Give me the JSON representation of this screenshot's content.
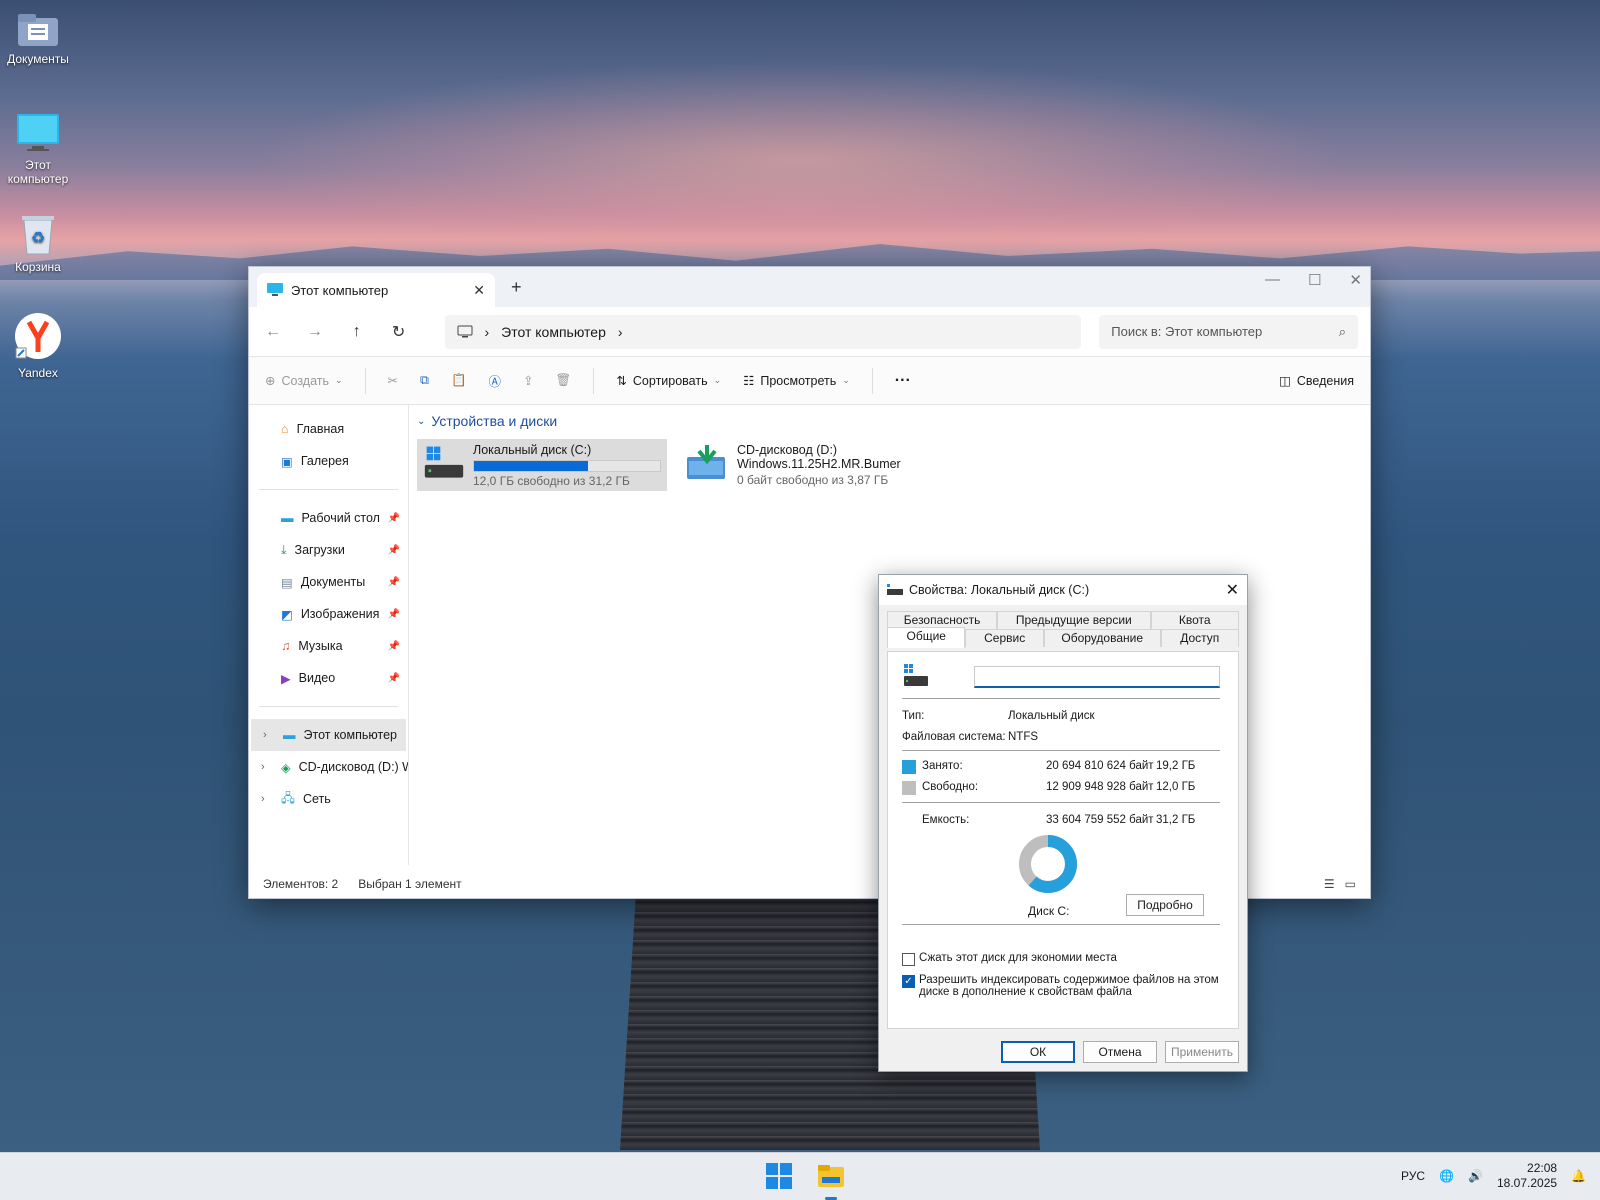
{
  "desktop": {
    "icons": [
      {
        "label": "Документы"
      },
      {
        "label": "Этот компьютер"
      },
      {
        "label": "Корзина"
      },
      {
        "label": "Yandex"
      }
    ]
  },
  "explorer": {
    "tab_title": "Этот компьютер",
    "address_path": "Этот компьютер",
    "search_placeholder": "Поиск в: Этот компьютер",
    "toolbar": {
      "create": "Создать",
      "sort": "Сортировать",
      "view": "Просмотреть",
      "details": "Сведения"
    },
    "nav": {
      "home": "Главная",
      "gallery": "Галерея",
      "desktop": "Рабочий стол",
      "downloads": "Загрузки",
      "documents": "Документы",
      "images": "Изображения",
      "music": "Музыка",
      "video": "Видео",
      "this_pc": "Этот компьютер",
      "cd_drive": "CD-дисковод (D:) W",
      "network": "Сеть"
    },
    "section_title": "Устройства и диски",
    "drives": [
      {
        "name": "Локальный диск (C:)",
        "sub": "12,0 ГБ свободно из 31,2 ГБ",
        "used_fraction": 0.615
      },
      {
        "name": "CD-дисковод (D:)",
        "label": "Windows.11.25H2.MR.Bumer",
        "sub": "0 байт свободно из 3,87 ГБ"
      }
    ],
    "status": {
      "items": "Элементов: 2",
      "selected": "Выбран 1 элемент"
    }
  },
  "properties": {
    "title": "Свойства: Локальный диск (C:)",
    "tabs_row1": [
      "Безопасность",
      "Предыдущие версии",
      "Квота"
    ],
    "tabs_row2": [
      "Общие",
      "Сервис",
      "Оборудование",
      "Доступ"
    ],
    "name_value": "",
    "type_label": "Тип:",
    "type_value": "Локальный диск",
    "fs_label": "Файловая система:",
    "fs_value": "NTFS",
    "used_label": "Занято:",
    "used_bytes": "20 694 810 624 байт",
    "used_gb": "19,2 ГБ",
    "free_label": "Свободно:",
    "free_bytes": "12 909 948 928 байт",
    "free_gb": "12,0 ГБ",
    "capacity_label": "Емкость:",
    "capacity_bytes": "33 604 759 552 байт",
    "capacity_gb": "31,2 ГБ",
    "used_fraction": 0.616,
    "disk_label": "Диск C:",
    "details_button": "Подробно",
    "compress_label": "Сжать этот диск для экономии места",
    "index_label_1": "Разрешить индексировать содержимое файлов на этом",
    "index_label_2": "диске в дополнение к свойствам файла",
    "ok": "ОК",
    "cancel": "Отмена",
    "apply": "Применить",
    "colors": {
      "used": "#26a0da",
      "free": "#bebebe"
    }
  },
  "taskbar": {
    "lang": "РУС",
    "time": "22:08",
    "date": "18.07.2025"
  }
}
